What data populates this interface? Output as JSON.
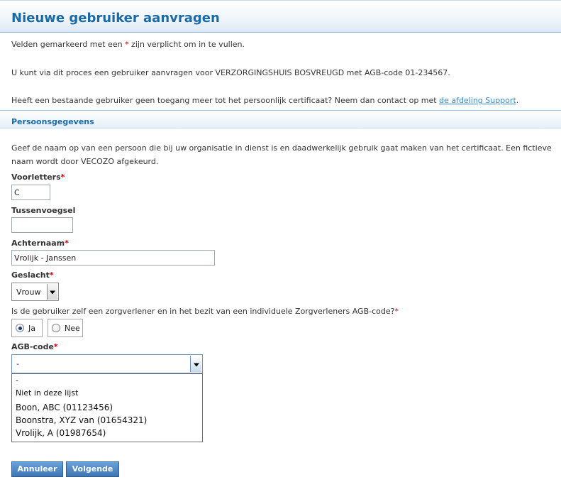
{
  "page": {
    "title": "Nieuwe gebruiker aanvragen"
  },
  "intro": {
    "required_pre": "Velden gemarkeerd met een ",
    "required_star": "*",
    "required_post": " zijn verplicht om in te vullen.",
    "process_text": "U kunt via dit proces een gebruiker aanvragen voor VERZORGINGSHUIS BOSVREUGD met AGB-code 01-234567.",
    "support_pre": "Heeft een bestaande gebruiker geen toegang meer tot het persoonlijk certificaat? Neem dan contact op met ",
    "support_link": "de afdeling Support",
    "support_post": "."
  },
  "section": {
    "title": "Persoonsgegevens",
    "description": "Geef de naam op van een persoon die bij uw organisatie in dienst is en daadwerkelijk gebruik gaat maken van het certificaat. Een fictieve naam wordt door VECOZO afgekeurd."
  },
  "form": {
    "required_mark": "*",
    "voorletters": {
      "label": "Voorletters",
      "value": "C"
    },
    "tussenvoegsel": {
      "label": "Tussenvoegsel",
      "value": ""
    },
    "achternaam": {
      "label": "Achternaam",
      "value": "Vrolijk - Janssen"
    },
    "geslacht": {
      "label": "Geslacht",
      "value": "Vrouw"
    },
    "zorgverlener": {
      "question": "Is de gebruiker zelf een zorgverlener en in het bezit van een individuele Zorgverleners AGB-code?",
      "options": [
        {
          "label": "Ja",
          "checked": true
        },
        {
          "label": "Nee",
          "checked": false
        }
      ]
    },
    "agb": {
      "label": "AGB-code",
      "selected": "-",
      "options": [
        "-",
        "Niet in deze lijst",
        "Boon, ABC (01123456)",
        "Boonstra, XYZ van (01654321)",
        "Vrolijk, A (01987654)"
      ]
    }
  },
  "buttons": {
    "cancel": "Annuleer",
    "next": "Volgende"
  },
  "colors": {
    "accent": "#1a6aa8",
    "required": "#cc0000",
    "link": "#3a8ad0",
    "button": "#4a82c0"
  }
}
